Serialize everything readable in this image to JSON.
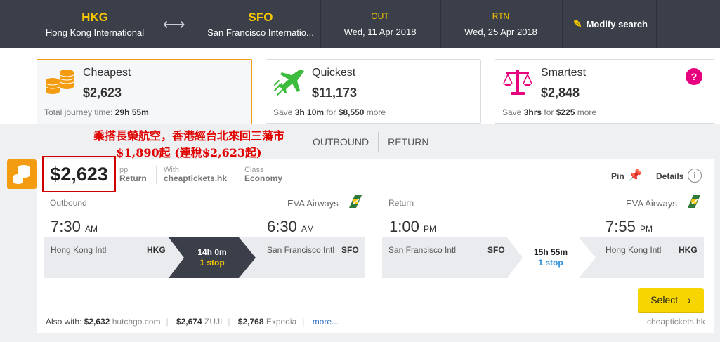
{
  "header": {
    "origin_code": "HKG",
    "origin_name": "Hong Kong International",
    "destination_code": "SFO",
    "destination_name": "San Francisco Internatio...",
    "out_label": "OUT",
    "out_date": "Wed, 11 Apr 2018",
    "rtn_label": "RTN",
    "rtn_date": "Wed, 25 Apr 2018",
    "modify_label": "Modify search",
    "swap_icon": "swap-arrows-icon"
  },
  "sort_tabs": [
    {
      "title": "Cheapest",
      "price": "$2,623",
      "sub_prefix": "Total journey time: ",
      "sub_bold": "29h 55m",
      "sub_mid": "",
      "sub_bold2": "",
      "sub_suffix": "",
      "icon": "coins-icon",
      "active": true
    },
    {
      "title": "Quickest",
      "price": "$11,173",
      "sub_prefix": "Save ",
      "sub_bold": "3h 10m",
      "sub_mid": " for ",
      "sub_bold2": "$8,550",
      "sub_suffix": " more",
      "icon": "plane-icon",
      "active": false
    },
    {
      "title": "Smartest",
      "price": "$2,848",
      "sub_prefix": "Save ",
      "sub_bold": "3hrs",
      "sub_mid": " for ",
      "sub_bold2": "$225",
      "sub_suffix": " more",
      "icon": "scales-icon",
      "active": false,
      "help": "?"
    }
  ],
  "annotation": {
    "line1": "乘搭長榮航空，香港經台北來回三藩市",
    "line2": "$1,890起 (連稅$2,623起)"
  },
  "switch": {
    "outbound": "OUTBOUND",
    "return": "RETURN"
  },
  "result": {
    "price": "$2,623",
    "pp_label": "pp",
    "pp_value": "Return",
    "with_label": "With",
    "with_value": "cheaptickets.hk",
    "class_label": "Class",
    "class_value": "Economy",
    "pin_label": "Pin",
    "details_label": "Details",
    "outbound": {
      "label": "Outbound",
      "airline": "EVA Airways",
      "dep_time": "7:30",
      "dep_ampm": "AM",
      "dep_city": "Hong Kong Intl",
      "dep_code": "HKG",
      "duration": "14h 0m",
      "stops": "1 stop",
      "arr_time": "6:30",
      "arr_ampm": "AM",
      "arr_city": "San Francisco Intl",
      "arr_code": "SFO"
    },
    "return": {
      "label": "Return",
      "airline": "EVA Airways",
      "dep_time": "1:00",
      "dep_ampm": "PM",
      "dep_city": "San Francisco Intl",
      "dep_code": "SFO",
      "duration": "15h 55m",
      "stops": "1 stop",
      "arr_time": "7:55",
      "arr_ampm": "PM",
      "arr_city": "Hong Kong Intl",
      "arr_code": "HKG"
    },
    "select_label": "Select",
    "also_label": "Also with:",
    "also": [
      {
        "price": "$2,632",
        "provider": "hutchgo.com"
      },
      {
        "price": "$2,674",
        "provider": "ZUJI"
      },
      {
        "price": "$2,768",
        "provider": "Expedia"
      }
    ],
    "more_label": "more...",
    "site": "cheaptickets.hk"
  },
  "colors": {
    "accent_yellow": "#f7c600",
    "orange": "#f39c12",
    "pink": "#e6007e",
    "green": "#3dbb3d",
    "link": "#2b6cc4",
    "topbar": "#3a3f4a"
  }
}
